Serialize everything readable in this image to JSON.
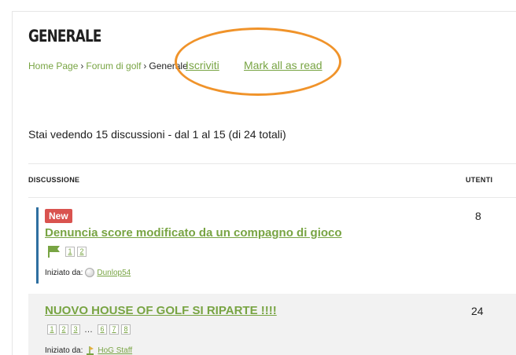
{
  "page": {
    "title": "GENERALE"
  },
  "breadcrumb": {
    "home": "Home Page",
    "separator": "›",
    "forum": "Forum di golf",
    "current": "Generale"
  },
  "actions": {
    "subscribe": "Iscriviti",
    "mark_read": "Mark all as read"
  },
  "summary": "Stai vedendo 15 discussioni - dal 1 al 15 (di 24 totali)",
  "columns": {
    "topic": "DISCUSSIONE",
    "users": "UTENTI"
  },
  "topics": [
    {
      "badge": "New",
      "title": "Denuncia score modificato da un compagno di gioco",
      "pages": [
        "1",
        "2"
      ],
      "started_label": "Iniziato da:",
      "author": "Dunlop54",
      "users": "8"
    },
    {
      "title": "NUOVO HOUSE OF GOLF SI RIPARTE !!!!",
      "pages_start": [
        "1",
        "2",
        "3"
      ],
      "ellipsis": "…",
      "pages_end": [
        "6",
        "7",
        "8"
      ],
      "started_label": "Iniziato da:",
      "author": "HoG Staff",
      "users": "24"
    }
  ],
  "colors": {
    "link": "#78a443",
    "badge": "#d9534f",
    "highlight_ring": "#f0932a",
    "sticky_bar": "#2e6fa0"
  }
}
